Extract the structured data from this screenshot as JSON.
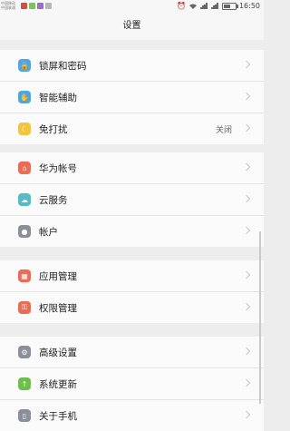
{
  "status_bar": {
    "carrier_line1": "中国移动",
    "carrier_line2": "中国联通",
    "time": "16:50",
    "battery_level": 0.6,
    "icons": [
      "app-red-icon",
      "app-green-icon",
      "app-purple-icon",
      "app-gray-icon",
      "alarm-icon",
      "wifi-icon",
      "signal-icon",
      "signal-icon",
      "battery-icon"
    ]
  },
  "header": {
    "title": "设置"
  },
  "groups": [
    {
      "items": [
        {
          "label": "锁屏和密码",
          "icon": "lock-icon",
          "color": "#4ea5e8",
          "value": ""
        },
        {
          "label": "智能辅助",
          "icon": "assist-icon",
          "color": "#48a8e6",
          "value": ""
        },
        {
          "label": "免打扰",
          "icon": "moon-icon",
          "color": "#f3c53b",
          "value": "关闭"
        }
      ]
    },
    {
      "items": [
        {
          "label": "华为帐号",
          "icon": "account-icon",
          "color": "#ef6a52",
          "value": ""
        },
        {
          "label": "云服务",
          "icon": "cloud-icon",
          "color": "#4fbec6",
          "value": ""
        },
        {
          "label": "帐户",
          "icon": "user-icon",
          "color": "#8a8f99",
          "value": ""
        }
      ]
    },
    {
      "items": [
        {
          "label": "应用管理",
          "icon": "apps-icon",
          "color": "#ef6a52",
          "value": ""
        },
        {
          "label": "权限管理",
          "icon": "permission-icon",
          "color": "#ef6a52",
          "value": ""
        }
      ]
    },
    {
      "items": [
        {
          "label": "高级设置",
          "icon": "gear-icon",
          "color": "#8a8f99",
          "value": ""
        },
        {
          "label": "系统更新",
          "icon": "update-icon",
          "color": "#6cc04a",
          "value": ""
        },
        {
          "label": "关于手机",
          "icon": "phone-icon",
          "color": "#8a8f99",
          "value": ""
        }
      ]
    }
  ]
}
